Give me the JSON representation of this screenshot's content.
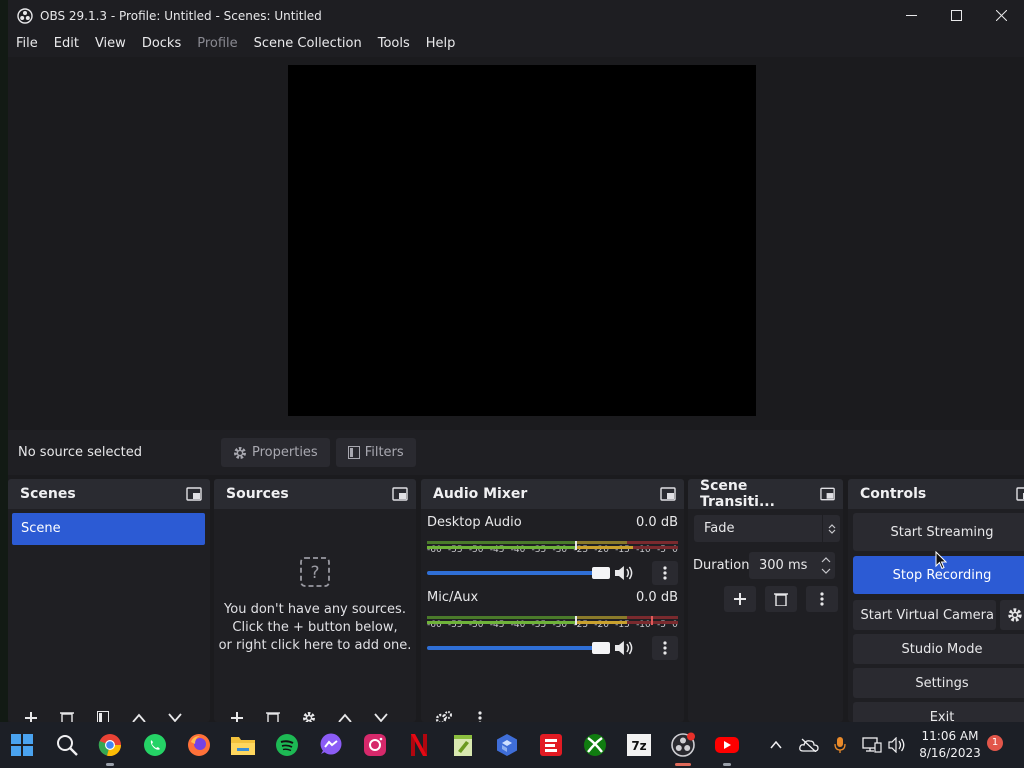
{
  "window": {
    "title": "OBS 29.1.3 - Profile: Untitled - Scenes: Untitled"
  },
  "menu": [
    "File",
    "Edit",
    "View",
    "Docks",
    "Profile",
    "Scene Collection",
    "Tools",
    "Help"
  ],
  "context_bar": {
    "status": "No source selected",
    "properties_label": "Properties",
    "filters_label": "Filters"
  },
  "scenes": {
    "title": "Scenes",
    "items": [
      "Scene"
    ]
  },
  "sources": {
    "title": "Sources",
    "empty_line1": "You don't have any sources.",
    "empty_line2": "Click the + button below,",
    "empty_line3": "or right click here to add one."
  },
  "audio_mixer": {
    "title": "Audio Mixer",
    "scale": [
      "-60",
      "-55",
      "-50",
      "-45",
      "-40",
      "-35",
      "-30",
      "-25",
      "-20",
      "-15",
      "-10",
      "-5",
      "0"
    ],
    "channels": [
      {
        "name": "Desktop Audio",
        "level": "0.0 dB",
        "volume": 1.0
      },
      {
        "name": "Mic/Aux",
        "level": "0.0 dB",
        "volume": 1.0
      }
    ]
  },
  "transitions": {
    "title": "Scene Transiti...",
    "selected": "Fade",
    "duration_label": "Duration",
    "duration_value": "300 ms"
  },
  "controls": {
    "title": "Controls",
    "start_streaming": "Start Streaming",
    "stop_recording": "Stop Recording",
    "start_virtual_camera": "Start Virtual Camera",
    "studio_mode": "Studio Mode",
    "settings": "Settings",
    "exit": "Exit"
  },
  "taskbar": {
    "time": "11:06 AM",
    "date": "8/16/2023",
    "notification_count": "1",
    "apps": [
      "start-icon",
      "search-icon",
      "chrome-icon",
      "whatsapp-icon",
      "firefox-icon",
      "file-explorer-icon",
      "spotify-icon",
      "messenger-icon",
      "instagram-icon",
      "netflix-icon",
      "notepad-plus-icon",
      "app-cube-icon",
      "espn-icon",
      "xbox-icon",
      "7zip-icon",
      "obs-icon",
      "youtube-icon"
    ]
  },
  "colors": {
    "accent_blue": "#2c5bd4",
    "panel": "#1f1f23",
    "panel_header": "#2a2b31",
    "meter_green": "#6fb33a",
    "meter_yellow": "#c9a12e",
    "meter_red": "#c0393b"
  }
}
